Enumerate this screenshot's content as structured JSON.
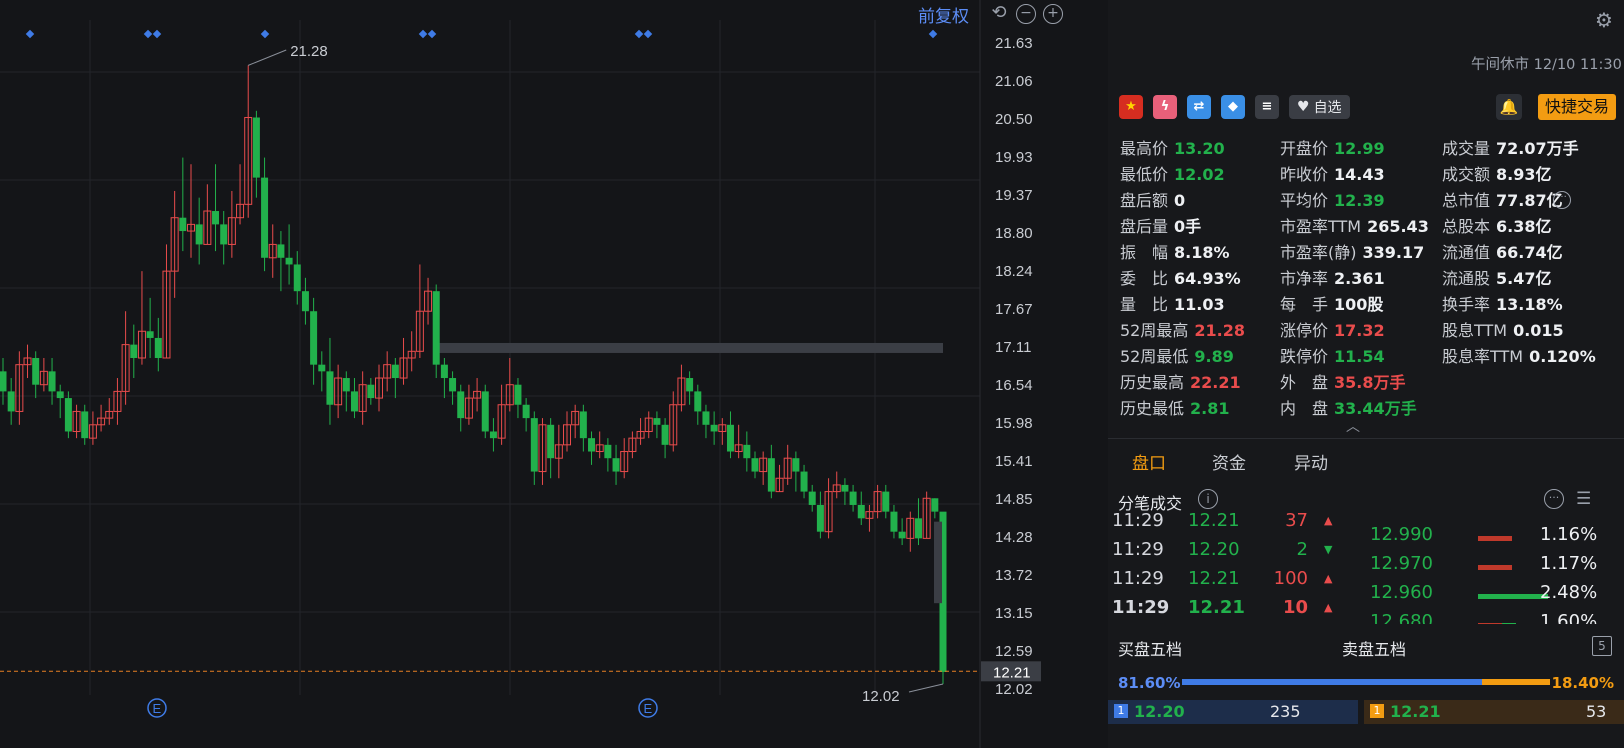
{
  "chart": {
    "price_adjust_label": "前复权",
    "y_ticks": [
      "21.63",
      "21.06",
      "20.50",
      "19.93",
      "19.37",
      "18.80",
      "18.24",
      "17.67",
      "17.11",
      "16.54",
      "15.98",
      "15.41",
      "14.85",
      "14.28",
      "13.72",
      "13.15",
      "12.59",
      "12.02"
    ],
    "current_price_tag": "12.21",
    "high_annotation": "21.28",
    "low_annotation": "12.02",
    "event_markers": [
      "E",
      "E"
    ],
    "colors": {
      "up": "#e94c4c",
      "down": "#22b14c",
      "grid": "#24262b",
      "accent": "#5c8df6",
      "last_price_line": "#e67e22"
    }
  },
  "chart_data": {
    "type": "candlestick",
    "ylim": [
      12.02,
      21.63
    ],
    "candles": [
      [
        16.7,
        16.4,
        16.9,
        16.2
      ],
      [
        16.4,
        16.1,
        16.6,
        15.9
      ],
      [
        16.1,
        16.8,
        17.0,
        15.9
      ],
      [
        16.8,
        16.9,
        17.1,
        16.6
      ],
      [
        16.9,
        16.5,
        17.0,
        16.3
      ],
      [
        16.5,
        16.7,
        16.9,
        16.4
      ],
      [
        16.7,
        16.4,
        16.9,
        16.2
      ],
      [
        16.4,
        16.3,
        16.5,
        16.0
      ],
      [
        16.3,
        15.8,
        16.4,
        15.7
      ],
      [
        15.8,
        16.1,
        16.2,
        15.7
      ],
      [
        16.1,
        15.7,
        16.2,
        15.6
      ],
      [
        15.7,
        15.9,
        16.1,
        15.6
      ],
      [
        15.9,
        16.0,
        16.2,
        15.8
      ],
      [
        16.0,
        16.1,
        16.3,
        15.9
      ],
      [
        16.1,
        16.4,
        16.6,
        15.9
      ],
      [
        16.4,
        17.1,
        17.6,
        16.2
      ],
      [
        17.1,
        16.9,
        17.4,
        16.6
      ],
      [
        16.9,
        17.3,
        18.2,
        16.8
      ],
      [
        17.3,
        17.2,
        17.8,
        16.9
      ],
      [
        17.2,
        16.9,
        17.5,
        16.7
      ],
      [
        16.9,
        18.2,
        18.6,
        16.9
      ],
      [
        18.2,
        19.0,
        19.4,
        17.8
      ],
      [
        19.0,
        18.8,
        19.9,
        18.5
      ],
      [
        18.8,
        18.9,
        19.8,
        18.4
      ],
      [
        18.9,
        18.6,
        19.3,
        18.3
      ],
      [
        18.6,
        19.1,
        19.5,
        18.6
      ],
      [
        19.1,
        18.9,
        19.8,
        18.5
      ],
      [
        18.9,
        18.6,
        19.1,
        18.3
      ],
      [
        18.6,
        19.0,
        19.4,
        18.4
      ],
      [
        19.0,
        19.2,
        19.8,
        18.9
      ],
      [
        19.2,
        20.5,
        21.28,
        19.0
      ],
      [
        20.5,
        19.6,
        20.6,
        19.3
      ],
      [
        19.6,
        18.4,
        19.9,
        18.2
      ],
      [
        18.4,
        18.6,
        18.9,
        18.1
      ],
      [
        18.6,
        18.4,
        18.8,
        17.9
      ],
      [
        18.4,
        18.3,
        18.9,
        18.0
      ],
      [
        18.3,
        17.9,
        18.5,
        17.7
      ],
      [
        17.9,
        17.6,
        18.1,
        17.4
      ],
      [
        17.6,
        16.8,
        17.8,
        16.5
      ],
      [
        16.8,
        16.7,
        17.0,
        16.4
      ],
      [
        16.7,
        16.2,
        17.2,
        15.9
      ],
      [
        16.2,
        16.6,
        16.8,
        16.0
      ],
      [
        16.6,
        16.4,
        16.7,
        16.1
      ],
      [
        16.4,
        16.1,
        16.6,
        16.0
      ],
      [
        16.1,
        16.5,
        16.7,
        15.9
      ],
      [
        16.5,
        16.3,
        16.6,
        16.2
      ],
      [
        16.3,
        16.6,
        16.8,
        16.1
      ],
      [
        16.6,
        16.8,
        17.0,
        16.4
      ],
      [
        16.8,
        16.6,
        16.9,
        16.3
      ],
      [
        16.6,
        16.9,
        17.2,
        16.5
      ],
      [
        16.9,
        17.0,
        17.3,
        16.7
      ],
      [
        17.0,
        17.6,
        18.3,
        16.9
      ],
      [
        17.6,
        17.9,
        18.1,
        17.4
      ],
      [
        17.9,
        16.8,
        18.0,
        16.6
      ],
      [
        16.8,
        16.6,
        16.9,
        16.3
      ],
      [
        16.6,
        16.4,
        16.7,
        16.2
      ],
      [
        16.4,
        16.0,
        16.5,
        15.8
      ],
      [
        16.0,
        16.3,
        16.5,
        15.9
      ],
      [
        16.3,
        16.4,
        16.6,
        16.1
      ],
      [
        16.4,
        15.8,
        16.5,
        15.7
      ],
      [
        15.8,
        15.7,
        16.0,
        15.5
      ],
      [
        15.7,
        16.2,
        16.5,
        15.6
      ],
      [
        16.2,
        16.5,
        16.9,
        16.1
      ],
      [
        16.5,
        16.2,
        16.6,
        16.0
      ],
      [
        16.2,
        16.0,
        16.3,
        15.8
      ],
      [
        16.0,
        15.2,
        16.1,
        15.0
      ],
      [
        15.2,
        15.9,
        16.0,
        15.0
      ],
      [
        15.9,
        15.4,
        16.0,
        15.1
      ],
      [
        15.4,
        15.6,
        15.9,
        15.1
      ],
      [
        15.6,
        15.9,
        16.1,
        15.5
      ],
      [
        15.9,
        16.1,
        16.2,
        15.7
      ],
      [
        16.1,
        15.7,
        16.2,
        15.5
      ],
      [
        15.7,
        15.5,
        15.8,
        15.3
      ],
      [
        15.5,
        15.6,
        15.8,
        15.4
      ],
      [
        15.6,
        15.4,
        15.7,
        15.2
      ],
      [
        15.4,
        15.2,
        15.6,
        15.0
      ],
      [
        15.2,
        15.5,
        15.7,
        15.1
      ],
      [
        15.5,
        15.7,
        15.8,
        15.4
      ],
      [
        15.7,
        15.8,
        16.0,
        15.6
      ],
      [
        15.8,
        16.0,
        16.1,
        15.7
      ],
      [
        16.0,
        15.9,
        16.1,
        15.7
      ],
      [
        15.9,
        15.6,
        16.0,
        15.4
      ],
      [
        15.6,
        16.2,
        16.4,
        15.5
      ],
      [
        16.2,
        16.6,
        16.8,
        16.1
      ],
      [
        16.6,
        16.4,
        16.7,
        16.2
      ],
      [
        16.4,
        16.1,
        16.5,
        15.9
      ],
      [
        16.1,
        15.9,
        16.2,
        15.7
      ],
      [
        15.9,
        15.8,
        16.1,
        15.6
      ],
      [
        15.8,
        15.9,
        16.0,
        15.6
      ],
      [
        15.9,
        15.5,
        16.1,
        15.4
      ],
      [
        15.5,
        15.6,
        15.9,
        15.4
      ],
      [
        15.6,
        15.4,
        15.8,
        15.2
      ],
      [
        15.4,
        15.2,
        15.5,
        15.1
      ],
      [
        15.2,
        15.4,
        15.5,
        15.0
      ],
      [
        15.4,
        14.9,
        15.6,
        14.8
      ],
      [
        14.9,
        15.1,
        15.3,
        14.9
      ],
      [
        15.1,
        15.4,
        15.6,
        15.0
      ],
      [
        15.4,
        15.2,
        15.5,
        14.9
      ],
      [
        15.2,
        14.9,
        15.3,
        14.8
      ],
      [
        14.9,
        14.7,
        15.0,
        14.6
      ],
      [
        14.7,
        14.3,
        14.9,
        14.2
      ],
      [
        14.3,
        14.9,
        15.1,
        14.2
      ],
      [
        14.9,
        15.0,
        15.2,
        14.8
      ],
      [
        15.0,
        14.9,
        15.1,
        14.7
      ],
      [
        14.9,
        14.7,
        15.0,
        14.6
      ],
      [
        14.7,
        14.5,
        14.9,
        14.4
      ],
      [
        14.5,
        14.6,
        14.7,
        14.3
      ],
      [
        14.6,
        14.9,
        15.0,
        14.5
      ],
      [
        14.9,
        14.6,
        15.0,
        14.5
      ],
      [
        14.6,
        14.3,
        14.7,
        14.2
      ],
      [
        14.3,
        14.2,
        14.5,
        14.1
      ],
      [
        14.2,
        14.5,
        14.6,
        14.0
      ],
      [
        14.5,
        14.2,
        14.8,
        14.1
      ],
      [
        14.2,
        14.8,
        14.9,
        14.2
      ],
      [
        14.8,
        14.6,
        14.8,
        14.5
      ],
      [
        14.6,
        12.2,
        13.2,
        12.02
      ]
    ],
    "resistance_level": 17.05,
    "title": "",
    "xlabel": "",
    "ylabel": ""
  },
  "panel": {
    "status": "午间休市 12/10 11:30",
    "watchlist_label": "自选",
    "quick_trade_label": "快捷交易",
    "stats": [
      {
        "label": "最高价",
        "value": "13.20",
        "color": "green"
      },
      {
        "label": "开盘价",
        "value": "12.99",
        "color": "green"
      },
      {
        "label": "成交量",
        "value": "72.07万手",
        "color": "white"
      },
      {
        "label": "最低价",
        "value": "12.02",
        "color": "green"
      },
      {
        "label": "昨收价",
        "value": "14.43",
        "color": "white"
      },
      {
        "label": "成交额",
        "value": "8.93亿",
        "color": "white"
      },
      {
        "label": "盘后额",
        "value": "0",
        "color": "white"
      },
      {
        "label": "平均价",
        "value": "12.39",
        "color": "green"
      },
      {
        "label": "总市值",
        "value": "77.87亿",
        "color": "white"
      },
      {
        "label": "盘后量",
        "value": "0手",
        "color": "white"
      },
      {
        "label": "市盈率TTM",
        "value": "265.43",
        "color": "white"
      },
      {
        "label": "总股本",
        "value": "6.38亿",
        "color": "white"
      },
      {
        "label": "振　幅",
        "value": "8.18%",
        "color": "white"
      },
      {
        "label": "市盈率(静)",
        "value": "339.17",
        "color": "white"
      },
      {
        "label": "流通值",
        "value": "66.74亿",
        "color": "white"
      },
      {
        "label": "委　比",
        "value": "64.93%",
        "color": "white"
      },
      {
        "label": "市净率",
        "value": "2.361",
        "color": "white"
      },
      {
        "label": "流通股",
        "value": "5.47亿",
        "color": "white"
      },
      {
        "label": "量　比",
        "value": "11.03",
        "color": "white"
      },
      {
        "label": "每　手",
        "value": "100股",
        "color": "white"
      },
      {
        "label": "换手率",
        "value": "13.18%",
        "color": "white"
      },
      {
        "label": "52周最高",
        "value": "21.28",
        "color": "red"
      },
      {
        "label": "涨停价",
        "value": "17.32",
        "color": "red"
      },
      {
        "label": "股息TTM",
        "value": "0.015",
        "color": "white"
      },
      {
        "label": "52周最低",
        "value": "9.89",
        "color": "green"
      },
      {
        "label": "跌停价",
        "value": "11.54",
        "color": "green"
      },
      {
        "label": "股息率TTM",
        "value": "0.120%",
        "color": "white"
      },
      {
        "label": "历史最高",
        "value": "22.21",
        "color": "red"
      },
      {
        "label": "外　盘",
        "value": "35.8万手",
        "color": "red"
      },
      {
        "label": "",
        "value": "",
        "color": "white"
      },
      {
        "label": "历史最低",
        "value": "2.81",
        "color": "green"
      },
      {
        "label": "内　盘",
        "value": "33.44万手",
        "color": "green"
      },
      {
        "label": "",
        "value": "",
        "color": "white"
      }
    ],
    "tabs": [
      "盘口",
      "资金",
      "异动"
    ],
    "tick_title": "分笔成交",
    "ticks": [
      {
        "time": "11:29",
        "price": "12.21",
        "vol": "37",
        "dir": "up",
        "bold": false
      },
      {
        "time": "11:29",
        "price": "12.20",
        "vol": "2",
        "dir": "down",
        "bold": false
      },
      {
        "time": "11:29",
        "price": "12.21",
        "vol": "100",
        "dir": "up",
        "bold": false
      },
      {
        "time": "11:29",
        "price": "12.21",
        "vol": "10",
        "dir": "up",
        "bold": true
      }
    ],
    "distribution": [
      {
        "price": "12.990",
        "pct": "1.16%",
        "bar": "red"
      },
      {
        "price": "12.970",
        "pct": "1.17%",
        "bar": "red"
      },
      {
        "price": "12.960",
        "pct": "2.48%",
        "bar": "green"
      },
      {
        "price": "12.680",
        "pct": "1.60%",
        "bar": "mixed"
      }
    ],
    "buy_book_title": "买盘五档",
    "sell_book_title": "卖盘五档",
    "book_levels_icon": "5",
    "buy_ratio": "81.60%",
    "sell_ratio": "18.40%",
    "buy_ratio_value": 0.816,
    "level1_buy": {
      "num": "1",
      "price": "12.20",
      "vol": "235"
    },
    "level1_sell": {
      "num": "1",
      "price": "12.21",
      "vol": "53"
    }
  }
}
